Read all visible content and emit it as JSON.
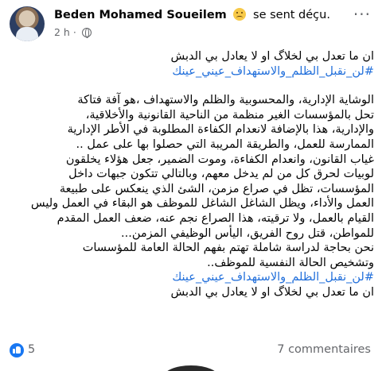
{
  "post": {
    "author_name": "Beden Mohamed Soueilem",
    "feeling_text": "se sent déçu.",
    "feeling_icon": "disappointed-face-icon",
    "time": "2 h ·",
    "audience_icon": "globe-icon",
    "more_label": "···",
    "lines": {
      "l1": "ان ما تعدل بي لخلاگ او لا يعادل بي الدبش",
      "l2": "#لن_نقبل_الظلم_والاستهداف_عيني_عينك",
      "l3": "الوشاية الإدارية، والمحسوبية والظلم والاستهداف ،هو آفة فتاكة",
      "l4": "تحل بالمؤسسات الغير منظمة من الناحية القانونية والأخلاقية،",
      "l5": "والإدارية، هذا بالإضافة لانعدام الكفاءة المطلوبة في الأطر الإدارية",
      "l6": "الممارسة للعمل، والطريقة المريبة التي حصلوا بها على عمل ..",
      "l7": "غياب القانون، وانعدام الكفاءة، وموت الضمير، جعل هؤلاء يخلقون",
      "l8": "لوبيات لحرق كل من لم يدخل معهم، وبالتالي تتكون جبهات داخل",
      "l9": "المؤسسات، تظل في صراع مزمن، الشئ الذي ينعكس على طبيعة",
      "l10": "العمل والأداء، ويظل الشاغل الشاغل للموظف هو البقاء في العمل وليس",
      "l11": "القيام بالعمل، ولا ترقيته، هذا الصراع نجم عنه، ضعف العمل المقدم",
      "l12": "للمواطن، قتل روح الفريق، اليأس الوظيفي المزمن...",
      "l13": "نحن بحاجة لدراسة شاملة تهتم بفهم الحالة العامة للمؤسسات",
      "l14": "وتشخيص الحالة النفسية للموظف..",
      "l15": "#لن_نقبل_الظلم_والاستهداف_عيني_عينك",
      "l16": "ان ما تعدل بي لخلاگ او لا يعادل بي الدبش"
    },
    "reactions": {
      "icon": "like-icon",
      "count": "5"
    },
    "comments_label": "7 commentaires"
  },
  "colors": {
    "hashtag": "#216fdb",
    "meta": "#65676b",
    "like_blue": "#1877f2"
  }
}
